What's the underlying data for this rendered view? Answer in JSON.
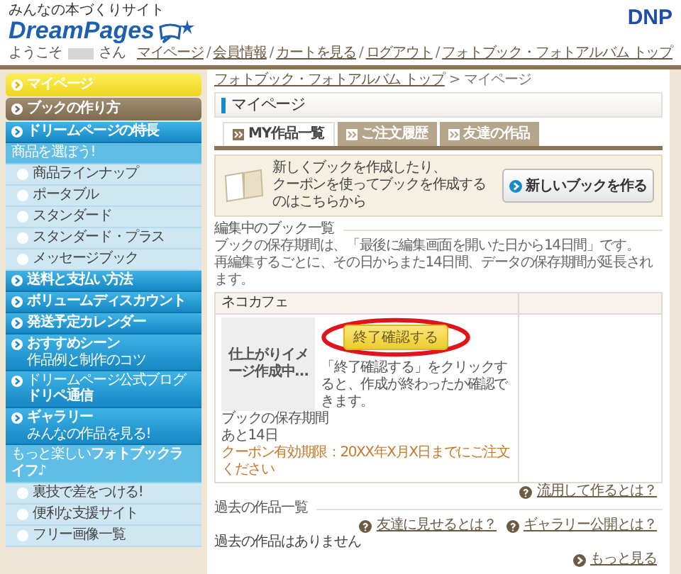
{
  "header": {
    "tagline": "みんなの本づくりサイト",
    "logo": "DreamPages",
    "brand": "DNP",
    "welcome_prefix": "ようこそ",
    "welcome_suffix": "さん",
    "link_separator": "/",
    "links": [
      "マイページ",
      "会員情報",
      "カートを見る",
      "ログアウト",
      "フォトブック・フォトアルバム トップ"
    ]
  },
  "sidebar": {
    "items": [
      {
        "kind": "top",
        "label": "マイページ",
        "selected": true
      },
      {
        "kind": "top",
        "label": "ブックの作り方",
        "selected": false
      },
      {
        "kind": "main",
        "label": "ドリームページの特長"
      },
      {
        "kind": "heading",
        "label": "商品を選ぼう!"
      },
      {
        "kind": "sub",
        "label": "商品ラインナップ"
      },
      {
        "kind": "sub",
        "label": "ポータブル"
      },
      {
        "kind": "sub",
        "label": "スタンダード"
      },
      {
        "kind": "sub",
        "label": "スタンダード・プラス"
      },
      {
        "kind": "sub",
        "label": "メッセージブック"
      },
      {
        "kind": "main",
        "label": "送料と支払い方法"
      },
      {
        "kind": "main",
        "label": "ボリュームディスカウント"
      },
      {
        "kind": "main",
        "label": "発送予定カレンダー"
      },
      {
        "kind": "main",
        "label": "おすすめシーン",
        "note": "作品例と制作のコツ"
      },
      {
        "kind": "main",
        "label": "ドリペ通信",
        "overline": "ドリームページ公式ブログ"
      },
      {
        "kind": "main",
        "label": "ギャラリー",
        "note": "みんなの作品を見る!"
      },
      {
        "kind": "heading",
        "label": "もっと楽しい**フォトブックライフ**♪"
      },
      {
        "kind": "sub",
        "label": "裏技で差をつける!"
      },
      {
        "kind": "sub",
        "label": "便利な支援サイト"
      },
      {
        "kind": "sub",
        "label": "フリー画像一覧"
      }
    ]
  },
  "breadcrumb": {
    "link": "フォトブック・フォトアルバム トップ",
    "separator": ">",
    "current": "マイページ"
  },
  "page_title": "マイページ",
  "tabs": [
    {
      "label": "MY作品一覧",
      "selected": true
    },
    {
      "label": "ご注文履歴",
      "selected": false
    },
    {
      "label": "友達の作品",
      "selected": false
    }
  ],
  "new_book": {
    "lines": [
      "新しくブックを作成したり、",
      "クーポンを使ってブックを作成するのはこちらから"
    ],
    "button": "新しいブックを作る"
  },
  "editing": {
    "heading": "編集中のブック一覧",
    "notes": [
      "ブックの保存期間は、「最後に編集画面を開いた日から14日間」です。",
      "再編集するごとに、その日からまた14日間、データの保存期間が延長されます。"
    ],
    "book": {
      "title": "ネコカフェ",
      "preview": "仕上がりイメージ作成中…",
      "button": "終了確認する",
      "note": "「終了確認する」をクリックすると、作成が終わったか確認できます。",
      "retention_label": "ブックの保存期間",
      "retention_value": "あと14日",
      "coupon": "クーポン有効期限：20XX年X月X日までにご注文ください"
    },
    "link": "流用して作るとは？"
  },
  "past": {
    "heading": "過去の作品一覧",
    "links": [
      "友達に見せるとは？",
      "ギャラリー公開とは？"
    ],
    "empty": "過去の作品はありません",
    "more": "もっと見る"
  }
}
